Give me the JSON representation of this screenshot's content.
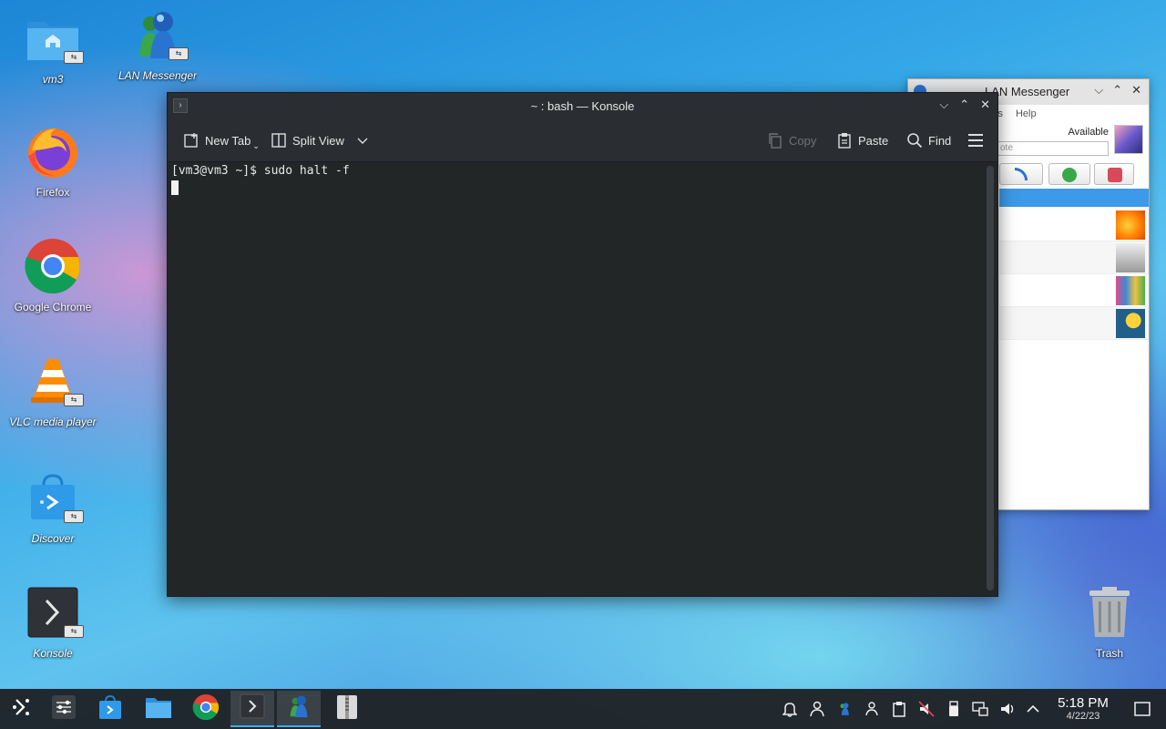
{
  "desktop": {
    "icons": [
      {
        "label": "vm3",
        "italic": true
      },
      {
        "label": "LAN Messenger",
        "italic": true
      },
      {
        "label": "Firefox",
        "italic": false
      },
      {
        "label": "Google Chrome",
        "italic": false
      },
      {
        "label": "VLC media player",
        "italic": true
      },
      {
        "label": "Discover",
        "italic": true
      },
      {
        "label": "Konsole",
        "italic": true
      },
      {
        "label": "Trash",
        "italic": false
      }
    ]
  },
  "lan_messenger": {
    "title": "LAN Messenger",
    "menu": [
      "ls",
      "Help"
    ],
    "status": "Available",
    "note_placeholder": "ote"
  },
  "konsole": {
    "title": "~ : bash — Konsole",
    "toolbar": {
      "new_tab": "New Tab",
      "split_view": "Split View",
      "copy": "Copy",
      "paste": "Paste",
      "find": "Find"
    },
    "terminal": {
      "line1": "[vm3@vm3 ~]$ sudo halt -f"
    }
  },
  "taskbar": {
    "apps": [
      "application-launcher",
      "system-settings",
      "discover",
      "dolphin",
      "google-chrome",
      "konsole",
      "lan-messenger",
      "ark"
    ],
    "active_app": "konsole",
    "clock": {
      "time": "5:18 PM",
      "date": "4/22/23"
    }
  },
  "colors": {
    "accent": "#3daee9",
    "terminal_bg": "#232627",
    "titlebar": "#2a2e32"
  }
}
